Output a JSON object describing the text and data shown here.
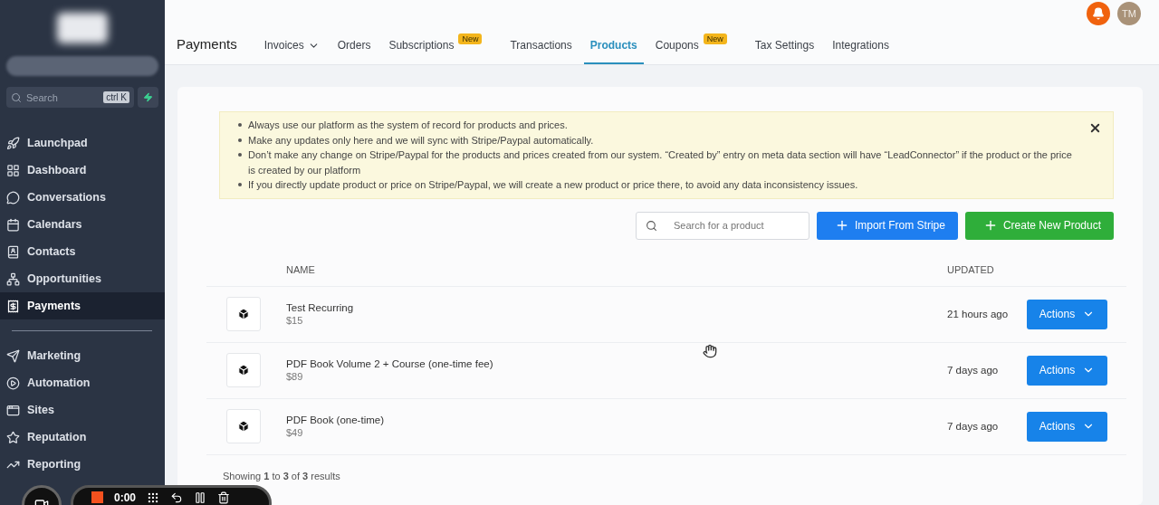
{
  "sidebar": {
    "search": {
      "placeholder": "Search",
      "shortcut": "ctrl K"
    },
    "items": [
      {
        "label": "Launchpad",
        "selected": false
      },
      {
        "label": "Dashboard",
        "selected": false
      },
      {
        "label": "Conversations",
        "selected": false
      },
      {
        "label": "Calendars",
        "selected": false
      },
      {
        "label": "Contacts",
        "selected": false
      },
      {
        "label": "Opportunities",
        "selected": false
      },
      {
        "label": "Payments",
        "selected": true
      }
    ],
    "items_2": [
      {
        "label": "Marketing",
        "selected": false
      },
      {
        "label": "Automation",
        "selected": false
      },
      {
        "label": "Sites",
        "selected": false
      },
      {
        "label": "Reputation",
        "selected": false
      },
      {
        "label": "Reporting",
        "selected": false
      }
    ]
  },
  "header": {
    "title": "Payments",
    "avatar": "TM",
    "tabs": [
      {
        "label": "Invoices",
        "dropdown": true,
        "selected": false
      },
      {
        "label": "Orders",
        "dropdown": false,
        "selected": false
      },
      {
        "label": "Subscriptions",
        "dropdown": false,
        "badge": "New",
        "selected": false
      },
      {
        "label": "Transactions",
        "dropdown": false,
        "selected": false
      },
      {
        "label": "Products",
        "dropdown": false,
        "selected": true
      },
      {
        "label": "Coupons",
        "dropdown": false,
        "badge": "New",
        "selected": false
      },
      {
        "label": "Tax Settings",
        "dropdown": false,
        "selected": false
      },
      {
        "label": "Integrations",
        "dropdown": false,
        "selected": false
      }
    ]
  },
  "notice": [
    "Always use our platform as the system of record for products and prices.",
    "Make any updates only here and we will sync with Stripe/Paypal automatically.",
    "Don’t make any change on Stripe/Paypal for the products and prices created from our system. “Created by” entry on meta data section will have “LeadConnector” if the product or the price is created by our platform",
    "If you directly update product or price on Stripe/Paypal, we will create a new product or price there, to avoid any data inconsistency issues."
  ],
  "toolbar": {
    "search_placeholder": "Search for a product",
    "import_button": "Import From Stripe",
    "create_button": "Create New Product"
  },
  "table": {
    "columns": [
      "NAME",
      "UPDATED"
    ],
    "rows": [
      {
        "name": "Test Recurring",
        "price": "$15",
        "updated": "21 hours ago",
        "action": "Actions"
      },
      {
        "name": "PDF Book Volume 2 + Course (one-time fee)",
        "price": "$89",
        "updated": "7 days ago",
        "action": "Actions"
      },
      {
        "name": "PDF Book (one-time)",
        "price": "$49",
        "updated": "7 days ago",
        "action": "Actions"
      }
    ],
    "footer": "Showing **1** to **3** of **3** results"
  },
  "recorder": {
    "time": "0:00"
  }
}
